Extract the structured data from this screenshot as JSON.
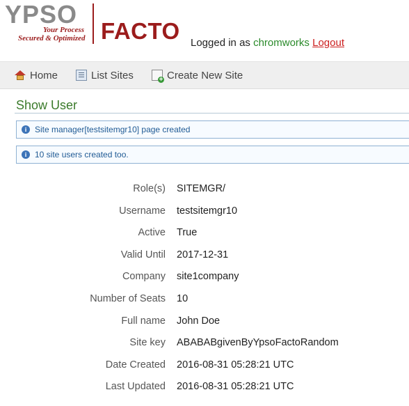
{
  "header": {
    "logo_ypso": "YPSO",
    "tagline_line1": "Your Process",
    "tagline_line2": "Secured & Optimized",
    "logo_facto": "FACTO",
    "logged_in_prefix": "Logged in as",
    "username": "chromworks",
    "logout_label": "Logout"
  },
  "nav": {
    "items": [
      {
        "label": "Home",
        "icon": "home-icon"
      },
      {
        "label": "List Sites",
        "icon": "list-icon"
      },
      {
        "label": "Create New Site",
        "icon": "new-site-icon"
      }
    ]
  },
  "page": {
    "title": "Show User"
  },
  "messages": [
    {
      "text": "Site manager[testsitemgr10] page created",
      "icon": "info-icon"
    },
    {
      "text": "10 site users created too.",
      "icon": "info-icon"
    }
  ],
  "details": [
    {
      "label": "Role(s)",
      "value": "SITEMGR/"
    },
    {
      "label": "Username",
      "value": "testsitemgr10"
    },
    {
      "label": "Active",
      "value": "True"
    },
    {
      "label": "Valid Until",
      "value": "2017-12-31"
    },
    {
      "label": "Company",
      "value": "site1company"
    },
    {
      "label": "Number of Seats",
      "value": "10"
    },
    {
      "label": "Full name",
      "value": "John Doe"
    },
    {
      "label": "Site key",
      "value": "ABABABgivenByYpsoFactoRandom"
    },
    {
      "label": "Date Created",
      "value": "2016-08-31 05:28:21 UTC"
    },
    {
      "label": "Last Updated",
      "value": "2016-08-31 05:28:21 UTC"
    }
  ],
  "colors": {
    "brand_red": "#9b1c1c",
    "logo_gray": "#8a8a8a",
    "title_green": "#3b7b2b",
    "user_green": "#2a8a2a",
    "logout_red": "#cc1f1f",
    "info_blue": "#1f5a94"
  }
}
